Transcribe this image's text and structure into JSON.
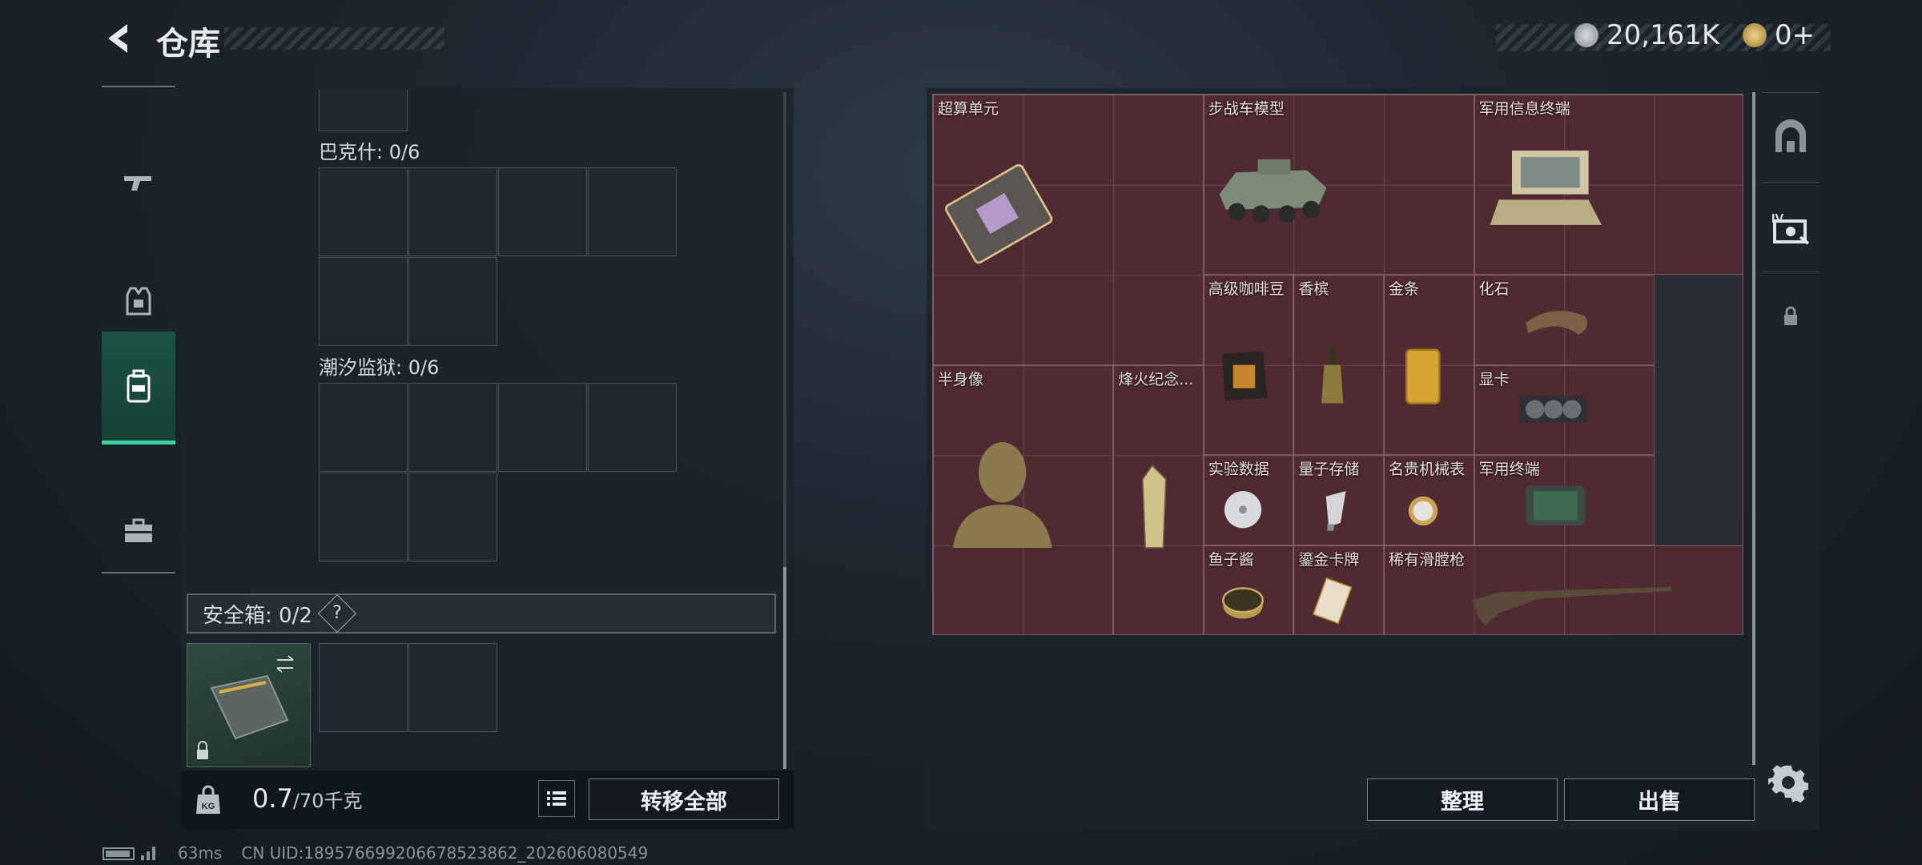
{
  "header": {
    "title": "仓库",
    "currency": "20,161K",
    "tokens": "0+"
  },
  "nav": {
    "items": [
      "weapons",
      "equipment",
      "backpack",
      "toolbox"
    ],
    "active": 2
  },
  "left": {
    "bakshi_label": "巴克什: 0/6",
    "chaoxi_label": "潮汐监狱: 0/6",
    "safe_label": "安全箱: 0/2",
    "safe_help": "?",
    "weight_value": "0.7",
    "weight_max": "/70千克",
    "transfer_label": "转移全部"
  },
  "grid_items": [
    {
      "name": "超算单元",
      "col": 0,
      "row": 0,
      "w": 3,
      "h": 3
    },
    {
      "name": "步战车模型",
      "col": 3,
      "row": 0,
      "w": 3,
      "h": 2
    },
    {
      "name": "军用信息终端",
      "col": 6,
      "row": 0,
      "w": 3,
      "h": 2
    },
    {
      "name": "高级咖啡豆",
      "col": 3,
      "row": 2,
      "w": 1,
      "h": 2
    },
    {
      "name": "香槟",
      "col": 4,
      "row": 2,
      "w": 1,
      "h": 2
    },
    {
      "name": "金条",
      "col": 5,
      "row": 2,
      "w": 1,
      "h": 2
    },
    {
      "name": "化石",
      "col": 6,
      "row": 2,
      "w": 2,
      "h": 1
    },
    {
      "name": "显卡",
      "col": 6,
      "row": 3,
      "w": 2,
      "h": 1
    },
    {
      "name": "半身像",
      "col": 0,
      "row": 3,
      "w": 2,
      "h": 3
    },
    {
      "name": "烽火纪念...",
      "col": 2,
      "row": 3,
      "w": 1,
      "h": 3
    },
    {
      "name": "实验数据",
      "col": 3,
      "row": 4,
      "w": 1,
      "h": 1
    },
    {
      "name": "量子存储",
      "col": 4,
      "row": 4,
      "w": 1,
      "h": 1
    },
    {
      "name": "名贵机械表",
      "col": 5,
      "row": 4,
      "w": 1,
      "h": 1
    },
    {
      "name": "军用终端",
      "col": 6,
      "row": 4,
      "w": 2,
      "h": 1
    },
    {
      "name": "鱼子酱",
      "col": 3,
      "row": 5,
      "w": 1,
      "h": 1
    },
    {
      "name": "鎏金卡牌",
      "col": 4,
      "row": 5,
      "w": 1,
      "h": 1
    },
    {
      "name": "稀有滑膛枪",
      "col": 5,
      "row": 5,
      "w": 4,
      "h": 1
    }
  ],
  "right": {
    "sort_label": "整理",
    "sell_label": "出售"
  },
  "status": {
    "ping": "63ms",
    "uid": "CN UID:189576699206678523862_202606080549"
  },
  "colors": {
    "accent": "#3cd39a",
    "grid_bg": "#4f2a30"
  }
}
